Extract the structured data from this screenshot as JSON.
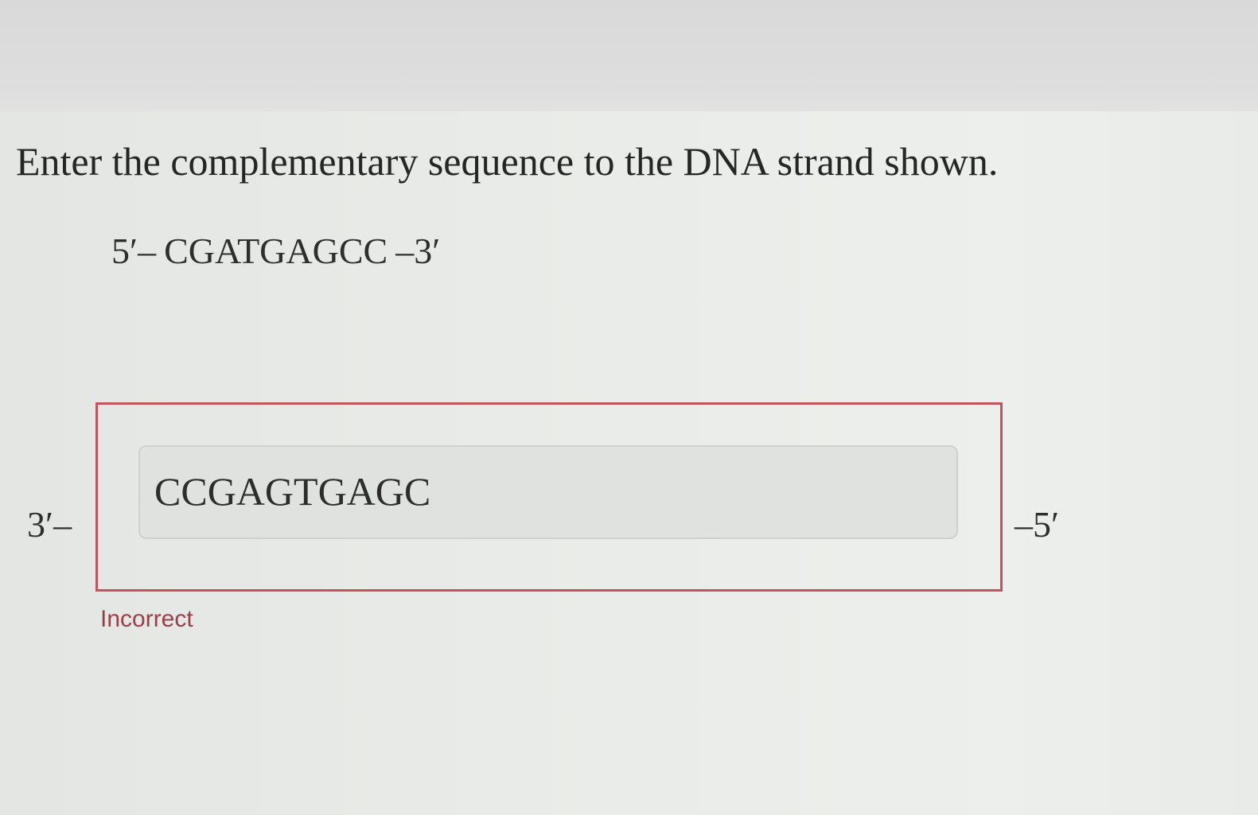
{
  "question": {
    "prompt": "Enter the complementary sequence to the DNA strand shown."
  },
  "given_strand": {
    "five_prime_label": "5′–",
    "sequence": "CGATGAGCC",
    "three_prime_label": "–3′"
  },
  "answer": {
    "left_label": "3′–",
    "value": "CCGAGTGAGC",
    "right_label": "–5′",
    "feedback": "Incorrect",
    "status_color": "#c0565b"
  }
}
